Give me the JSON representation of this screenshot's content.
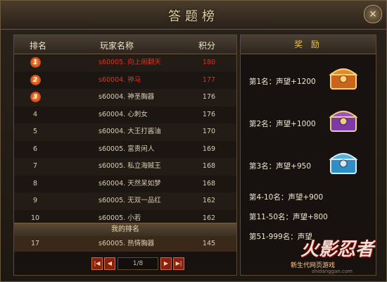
{
  "title": "答题榜",
  "close_label": "×",
  "columns": {
    "rank": "排名",
    "name": "玩家名称",
    "score": "积分"
  },
  "rows": [
    {
      "rank": "1",
      "name": "s60005. 向上闹翻天",
      "score": "180"
    },
    {
      "rank": "2",
      "name": "s60004. 神马",
      "score": "177"
    },
    {
      "rank": "3",
      "name": "s60004. 神圣胸器",
      "score": "176"
    },
    {
      "rank": "4",
      "name": "s60004. 心刺女",
      "score": "176"
    },
    {
      "rank": "5",
      "name": "s60004. 大王打酱油",
      "score": "170"
    },
    {
      "rank": "6",
      "name": "s60005. 富贵闲人",
      "score": "169"
    },
    {
      "rank": "7",
      "name": "s60005. 私立海賊王",
      "score": "168"
    },
    {
      "rank": "8",
      "name": "s60004. 天然呆如梦",
      "score": "168"
    },
    {
      "rank": "9",
      "name": "s60005. 无双一品红",
      "score": "162"
    },
    {
      "rank": "10",
      "name": "s60005. 小若",
      "score": "162"
    }
  ],
  "my_rank": {
    "label": "我的排名",
    "rank": "17",
    "name": "s60005. 热情胸器",
    "score": "145"
  },
  "pager": {
    "text": "1/8",
    "first": "|◀",
    "prev": "◀",
    "next": "▶",
    "last": "▶|"
  },
  "rewards": {
    "header": "奖 励",
    "items": [
      {
        "label": "第1名：声望+1200",
        "chest": "gold-chest-icon"
      },
      {
        "label": "第2名：声望+1000",
        "chest": "purple-chest-icon"
      },
      {
        "label": "第3名：声望+950",
        "chest": "blue-chest-icon"
      }
    ],
    "tiers": [
      "第4-10名：声望+900",
      "第11-50名：声望+800",
      "第51-999名：声望"
    ]
  },
  "watermark": {
    "logo": "火影忍者",
    "sub": "新生代网页游戏",
    "url": "shidanggan.com"
  },
  "colors": {
    "accent_red": "#e0301e",
    "gold": "#f0c040",
    "panel_border": "#5c4b33"
  }
}
